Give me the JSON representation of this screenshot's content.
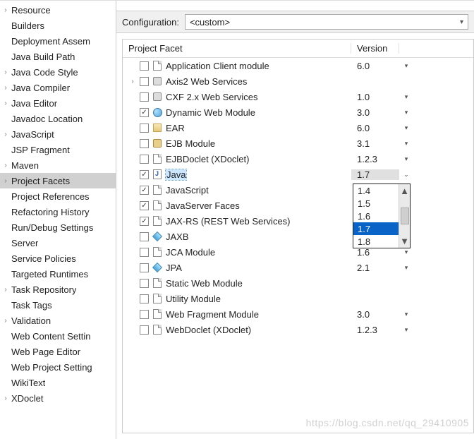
{
  "sidebar": {
    "items": [
      {
        "label": "Resource",
        "expandable": true
      },
      {
        "label": "Builders",
        "expandable": false
      },
      {
        "label": "Deployment Assem",
        "expandable": false
      },
      {
        "label": "Java Build Path",
        "expandable": false
      },
      {
        "label": "Java Code Style",
        "expandable": true
      },
      {
        "label": "Java Compiler",
        "expandable": true
      },
      {
        "label": "Java Editor",
        "expandable": true
      },
      {
        "label": "Javadoc Location",
        "expandable": false
      },
      {
        "label": "JavaScript",
        "expandable": true
      },
      {
        "label": "JSP Fragment",
        "expandable": false
      },
      {
        "label": "Maven",
        "expandable": true
      },
      {
        "label": "Project Facets",
        "expandable": true,
        "selected": true
      },
      {
        "label": "Project References",
        "expandable": false
      },
      {
        "label": "Refactoring History",
        "expandable": false
      },
      {
        "label": "Run/Debug Settings",
        "expandable": false
      },
      {
        "label": "Server",
        "expandable": false
      },
      {
        "label": "Service Policies",
        "expandable": false
      },
      {
        "label": "Targeted Runtimes",
        "expandable": false
      },
      {
        "label": "Task Repository",
        "expandable": true
      },
      {
        "label": "Task Tags",
        "expandable": false
      },
      {
        "label": "Validation",
        "expandable": true
      },
      {
        "label": "Web Content Settin",
        "expandable": false
      },
      {
        "label": "Web Page Editor",
        "expandable": false
      },
      {
        "label": "Web Project Setting",
        "expandable": false
      },
      {
        "label": "WikiText",
        "expandable": false
      },
      {
        "label": "XDoclet",
        "expandable": true
      }
    ]
  },
  "config": {
    "label": "Configuration:",
    "value": "<custom>"
  },
  "columns": {
    "name": "Project Facet",
    "version": "Version"
  },
  "facets": [
    {
      "label": "Application Client module",
      "checked": false,
      "version": "6.0",
      "dd": true,
      "icon": "doc"
    },
    {
      "label": "Axis2 Web Services",
      "checked": false,
      "version": "",
      "dd": false,
      "icon": "engine",
      "expandable": true
    },
    {
      "label": "CXF 2.x Web Services",
      "checked": false,
      "version": "1.0",
      "dd": true,
      "icon": "engine"
    },
    {
      "label": "Dynamic Web Module",
      "checked": true,
      "version": "3.0",
      "dd": true,
      "icon": "globe"
    },
    {
      "label": "EAR",
      "checked": false,
      "version": "6.0",
      "dd": true,
      "icon": "box"
    },
    {
      "label": "EJB Module",
      "checked": false,
      "version": "3.1",
      "dd": true,
      "icon": "jar"
    },
    {
      "label": "EJBDoclet (XDoclet)",
      "checked": false,
      "version": "1.2.3",
      "dd": true,
      "icon": "doc"
    },
    {
      "label": "Java",
      "checked": true,
      "version": "1.7",
      "dd": true,
      "icon": "java",
      "selected": true
    },
    {
      "label": "JavaScript",
      "checked": true,
      "version": "",
      "dd": false,
      "icon": "doc"
    },
    {
      "label": "JavaServer Faces",
      "checked": true,
      "version": "",
      "dd": false,
      "icon": "doc"
    },
    {
      "label": "JAX-RS (REST Web Services)",
      "checked": true,
      "version": "",
      "dd": false,
      "icon": "doc"
    },
    {
      "label": "JAXB",
      "checked": false,
      "version": "",
      "dd": false,
      "icon": "diamond"
    },
    {
      "label": "JCA Module",
      "checked": false,
      "version": "1.6",
      "dd": true,
      "icon": "doc"
    },
    {
      "label": "JPA",
      "checked": false,
      "version": "2.1",
      "dd": true,
      "icon": "diamond"
    },
    {
      "label": "Static Web Module",
      "checked": false,
      "version": "",
      "dd": false,
      "icon": "doc"
    },
    {
      "label": "Utility Module",
      "checked": false,
      "version": "",
      "dd": false,
      "icon": "doc"
    },
    {
      "label": "Web Fragment Module",
      "checked": false,
      "version": "3.0",
      "dd": true,
      "icon": "doc"
    },
    {
      "label": "WebDoclet (XDoclet)",
      "checked": false,
      "version": "1.2.3",
      "dd": true,
      "icon": "doc"
    }
  ],
  "version_dropdown": {
    "options": [
      "1.4",
      "1.5",
      "1.6",
      "1.7",
      "1.8"
    ],
    "selected": "1.7"
  },
  "watermark": "https://blog.csdn.net/qq_29410905"
}
